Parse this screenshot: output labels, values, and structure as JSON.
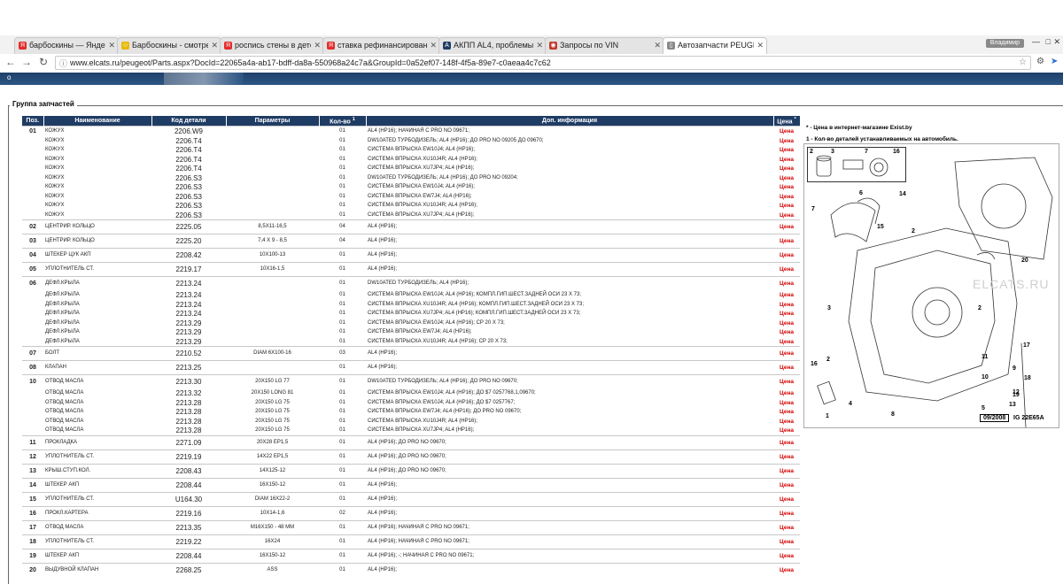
{
  "browser": {
    "tabs": [
      {
        "label": "барбоскины — Яндекс",
        "icon_color": "#e22c2c",
        "icon_char": "Я"
      },
      {
        "label": "Барбоскины - смотреть",
        "icon_color": "#e8b800",
        "icon_char": "☺"
      },
      {
        "label": "роспись стены в детско",
        "icon_color": "#e22c2c",
        "icon_char": "Я"
      },
      {
        "label": "ставка рефинансирован",
        "icon_color": "#e22c2c",
        "icon_char": "Я"
      },
      {
        "label": "АКПП AL4, проблемы -",
        "icon_color": "#1f3c64",
        "icon_char": "A"
      },
      {
        "label": "Запросы по VIN",
        "icon_color": "#c0392b",
        "icon_char": "◉"
      },
      {
        "label": "Автозапчасти PEUGEOT",
        "icon_color": "#888888",
        "icon_char": "▯"
      }
    ],
    "user": "Владимир",
    "url": "www.elcats.ru/peugeot/Parts.aspx?DocId=22065a4a-ab17-bdff-da8a-550968a24c7a&GroupId=0a52ef07-148f-4f5a-89e7-c0aeaa4c7c62"
  },
  "page": {
    "group_label": "Группа запчастей",
    "headers": {
      "pos": "Поз.",
      "name": "Наименование",
      "code": "Код детали",
      "params": "Параметры",
      "qty": "Кол-во",
      "qty_sup": "1",
      "info": "Доп. информация",
      "price": "Цена",
      "price_sup": "*"
    },
    "price_link": "Цена",
    "notes": [
      "* - Цена в интернет-магазине Exist.by",
      "1 - Кол-во деталей устанавливаемых на автомобиль."
    ],
    "diagram": {
      "caption_date": "09/2008",
      "caption_code": "IG 22E65A",
      "watermark": "ELCATS.RU",
      "inset_labels": [
        "2",
        "3",
        "7",
        "16"
      ],
      "callouts": [
        "6",
        "7",
        "14",
        "15",
        "2",
        "20",
        "3",
        "2",
        "2",
        "16",
        "9",
        "17",
        "11",
        "18",
        "10",
        "12",
        "19",
        "13",
        "5",
        "4",
        "8",
        "1"
      ]
    },
    "rows": [
      {
        "pos": "01",
        "name": "КОЖУХ",
        "code": "2206.W9",
        "params": "",
        "qty": "01",
        "info": "AL4 (HP16); НАЧИНАЯ С PRO NO 09671;",
        "sep": true
      },
      {
        "pos": "",
        "name": "КОЖУХ",
        "code": "2206.T4",
        "params": "",
        "qty": "01",
        "info": "DW10ATED ТУРБОДИЗЕЛЬ; AL4 (HP16); ДО PRO NO 09205 ДО 09670;"
      },
      {
        "pos": "",
        "name": "КОЖУХ",
        "code": "2206.T4",
        "params": "",
        "qty": "01",
        "info": "СИСТЕМА ВПРЫСКА EW10J4; AL4 (HP16);"
      },
      {
        "pos": "",
        "name": "КОЖУХ",
        "code": "2206.T4",
        "params": "",
        "qty": "01",
        "info": "СИСТЕМА ВПРЫСКА XU10J4R; AL4 (HP16);"
      },
      {
        "pos": "",
        "name": "КОЖУХ",
        "code": "2206.T4",
        "params": "",
        "qty": "01",
        "info": "СИСТЕМА ВПРЫСКА XU7JP4; AL4 (HP16);"
      },
      {
        "pos": "",
        "name": "КОЖУХ",
        "code": "2206.S3",
        "params": "",
        "qty": "01",
        "info": "DW10ATED ТУРБОДИЗЕЛЬ; AL4 (HP16); ДО PRO NO 09204;"
      },
      {
        "pos": "",
        "name": "КОЖУХ",
        "code": "2206.S3",
        "params": "",
        "qty": "01",
        "info": "СИСТЕМА ВПРЫСКА EW10J4; AL4 (HP16);"
      },
      {
        "pos": "",
        "name": "КОЖУХ",
        "code": "2206.S3",
        "params": "",
        "qty": "01",
        "info": "СИСТЕМА ВПРЫСКА EW7J4; AL4 (HP16);"
      },
      {
        "pos": "",
        "name": "КОЖУХ",
        "code": "2206.S3",
        "params": "",
        "qty": "01",
        "info": "СИСТЕМА ВПРЫСКА XU10J4R; AL4 (HP16);"
      },
      {
        "pos": "",
        "name": "КОЖУХ",
        "code": "2206.S3",
        "params": "",
        "qty": "01",
        "info": "СИСТЕМА ВПРЫСКА XU7JP4; AL4 (HP16);"
      },
      {
        "pos": "02",
        "name": "ЦЕНТРИР. КОЛЬЦО",
        "code": "2225.05",
        "params": "8,5X11-16,5",
        "qty": "04",
        "info": "AL4 (HP16);",
        "sep": true
      },
      {
        "pos": "03",
        "name": "ЦЕНТРИР. КОЛЬЦО",
        "code": "2225.20",
        "params": "7,4 X 9 - 8,5",
        "qty": "04",
        "info": "AL4 (HP16);",
        "sep": true
      },
      {
        "pos": "04",
        "name": "ШТЕКЕР ЦУК АКП",
        "code": "2208.42",
        "params": "10X100-13",
        "qty": "01",
        "info": "AL4 (HP16);",
        "sep": true
      },
      {
        "pos": "05",
        "name": "УПЛОТНИТЕЛЬ СТ.",
        "code": "2219.17",
        "params": "10X16-1,5",
        "qty": "01",
        "info": "AL4 (HP16);",
        "sep": true
      },
      {
        "pos": "06",
        "name": "ДЕФЛ.КРЫЛА",
        "code": "2213.24",
        "params": "",
        "qty": "01",
        "info": "DW10ATED ТУРБОДИЗЕЛЬ; AL4 (HP16);",
        "sep": true
      },
      {
        "pos": "",
        "name": "ДЕФЛ.КРЫЛА",
        "code": "2213.24",
        "params": "",
        "qty": "01",
        "info": "СИСТЕМА ВПРЫСКА EW10J4; AL4 (HP16); КОМПЛ.ГИП.ШЕСТ.ЗАДНЕЙ ОСИ 23 X 73;"
      },
      {
        "pos": "",
        "name": "ДЕФЛ.КРЫЛА",
        "code": "2213.24",
        "params": "",
        "qty": "01",
        "info": "СИСТЕМА ВПРЫСКА XU10J4R; AL4 (HP16); КОМПЛ.ГИП.ШЕСТ.ЗАДНЕЙ ОСИ 23 X 73;"
      },
      {
        "pos": "",
        "name": "ДЕФЛ.КРЫЛА",
        "code": "2213.24",
        "params": "",
        "qty": "01",
        "info": "СИСТЕМА ВПРЫСКА XU7JP4; AL4 (HP16); КОМПЛ.ГИП.ШЕСТ.ЗАДНЕЙ ОСИ 23 X 73;"
      },
      {
        "pos": "",
        "name": "ДЕФЛ.КРЫЛА",
        "code": "2213.29",
        "params": "",
        "qty": "01",
        "info": "СИСТЕМА ВПРЫСКА EW10J4; AL4 (HP16); CP 20 X 73;"
      },
      {
        "pos": "",
        "name": "ДЕФЛ.КРЫЛА",
        "code": "2213.29",
        "params": "",
        "qty": "01",
        "info": "СИСТЕМА ВПРЫСКА EW7J4; AL4 (HP16);"
      },
      {
        "pos": "",
        "name": "ДЕФЛ.КРЫЛА",
        "code": "2213.29",
        "params": "",
        "qty": "01",
        "info": "СИСТЕМА ВПРЫСКА XU10J4R; AL4 (HP16); CP 20 X 73;"
      },
      {
        "pos": "07",
        "name": "БОЛТ",
        "code": "2210.52",
        "params": "DIAM 6X100-16",
        "qty": "03",
        "info": "AL4 (HP16);",
        "sep": true
      },
      {
        "pos": "08",
        "name": "КЛАПАН",
        "code": "2213.25",
        "params": "",
        "qty": "01",
        "info": "AL4 (HP16);",
        "sep": true
      },
      {
        "pos": "10",
        "name": "ОТВОД МАСЛА",
        "code": "2213.30",
        "params": "20X150 LG 77",
        "qty": "01",
        "info": "DW10ATED ТУРБОДИЗЕЛЬ; AL4 (HP16); ДО PRO NO 09670;",
        "sep": true
      },
      {
        "pos": "",
        "name": "ОТВОД МАСЛА",
        "code": "2213.32",
        "params": "20X150 LONG 81",
        "qty": "01",
        "info": "СИСТЕМА ВПРЫСКА EW10J4; AL4 (HP16); ДО $7 0257768,1,09670;"
      },
      {
        "pos": "",
        "name": "ОТВОД МАСЛА",
        "code": "2213.28",
        "params": "20X150 LG 75",
        "qty": "01",
        "info": "СИСТЕМА ВПРЫСКА EW10J4; AL4 (HP16); ДО $7 0257767;"
      },
      {
        "pos": "",
        "name": "ОТВОД МАСЛА",
        "code": "2213.28",
        "params": "20X150 LG 75",
        "qty": "01",
        "info": "СИСТЕМА ВПРЫСКА EW7J4; AL4 (HP16); ДО PRO NO 09670;"
      },
      {
        "pos": "",
        "name": "ОТВОД МАСЛА",
        "code": "2213.28",
        "params": "20X150 LG 75",
        "qty": "01",
        "info": "СИСТЕМА ВПРЫСКА XU10J4R; AL4 (HP16);"
      },
      {
        "pos": "",
        "name": "ОТВОД МАСЛА",
        "code": "2213.28",
        "params": "20X150 LG 75",
        "qty": "01",
        "info": "СИСТЕМА ВПРЫСКА XU7JP4; AL4 (HP16);"
      },
      {
        "pos": "11",
        "name": "ПРОКЛАДКА",
        "code": "2271.09",
        "params": "20X28 EP1,5",
        "qty": "01",
        "info": "AL4 (HP16); ДО PRO NO 09670;",
        "sep": true
      },
      {
        "pos": "12",
        "name": "УПЛОТНИТЕЛЬ СТ.",
        "code": "2219.19",
        "params": "14X22 EP1,5",
        "qty": "01",
        "info": "AL4 (HP16); ДО PRO NO 09670;",
        "sep": true
      },
      {
        "pos": "13",
        "name": "КРЫШ.СТУП.КОЛ.",
        "code": "2208.43",
        "params": "14X125-12",
        "qty": "01",
        "info": "AL4 (HP16); ДО PRO NO 09670;",
        "sep": true
      },
      {
        "pos": "14",
        "name": "ШТЕКЕР АКП",
        "code": "2208.44",
        "params": "16X150-12",
        "qty": "01",
        "info": "AL4 (HP16);",
        "sep": true
      },
      {
        "pos": "15",
        "name": "УПЛОТНИТЕЛЬ СТ.",
        "code": "U164.30",
        "params": "DIAM 16X22-2",
        "qty": "01",
        "info": "AL4 (HP16);",
        "sep": true
      },
      {
        "pos": "16",
        "name": "ПРОКЛ.КАРТЕРА",
        "code": "2219.16",
        "params": "10X14-1,6",
        "qty": "02",
        "info": "AL4 (HP16);",
        "sep": true
      },
      {
        "pos": "17",
        "name": "ОТВОД МАСЛА",
        "code": "2213.35",
        "params": "M16X150 - 48 MM",
        "qty": "01",
        "info": "AL4 (HP16); НАЧИНАЯ С PRO NO 09671;",
        "sep": true
      },
      {
        "pos": "18",
        "name": "УПЛОТНИТЕЛЬ СТ.",
        "code": "2219.22",
        "params": "16X24",
        "qty": "01",
        "info": "AL4 (HP16); НАЧИНАЯ С PRO NO 09671;",
        "sep": true
      },
      {
        "pos": "19",
        "name": "ШТЕКЕР АКП",
        "code": "2208.44",
        "params": "16X150-12",
        "qty": "01",
        "info": "AL4 (HP16); -; НАЧИНАЯ С PRO NO 09671;",
        "sep": true
      },
      {
        "pos": "20",
        "name": "ВЫДУВНОЙ КЛАПАН",
        "code": "2268.25",
        "params": "ASS",
        "qty": "01",
        "info": "AL4 (HP16);",
        "sep": true
      }
    ]
  }
}
